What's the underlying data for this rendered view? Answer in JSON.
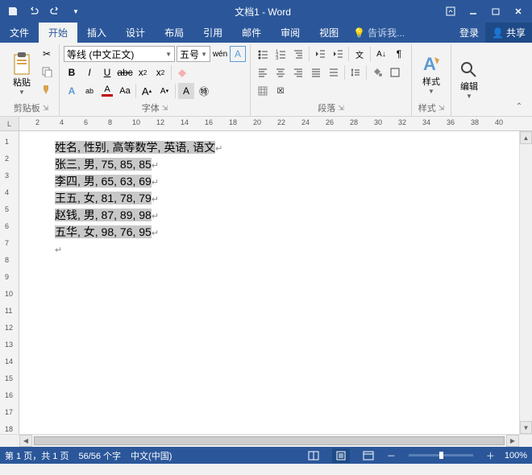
{
  "titlebar": {
    "doctitle": "文档1 - Word"
  },
  "tabs": {
    "file": "文件",
    "home": "开始",
    "insert": "插入",
    "design": "设计",
    "layout": "布局",
    "references": "引用",
    "mailings": "邮件",
    "review": "审阅",
    "view": "视图",
    "tell": "告诉我...",
    "signin": "登录",
    "share": "共享"
  },
  "ribbon": {
    "clipboard": {
      "paste": "粘贴",
      "label": "剪贴板"
    },
    "font": {
      "name": "等线 (中文正文)",
      "size": "五号",
      "bold": "B",
      "italic": "I",
      "underline": "U",
      "label": "字体"
    },
    "paragraph": {
      "label": "段落"
    },
    "styles": {
      "btn": "样式",
      "label": "样式"
    },
    "editing": {
      "btn": "编辑"
    }
  },
  "ruler": {
    "h_numbers": [
      "2",
      "4",
      "6",
      "8",
      "10",
      "12",
      "14",
      "16",
      "18",
      "20",
      "22",
      "24",
      "26",
      "28",
      "30",
      "32",
      "34",
      "36",
      "38",
      "40"
    ],
    "v_numbers": [
      "1",
      "2",
      "3",
      "4",
      "5",
      "6",
      "7",
      "8",
      "9",
      "10",
      "11",
      "12",
      "13",
      "14",
      "15",
      "16",
      "17",
      "18"
    ]
  },
  "document": {
    "lines": [
      "姓名, 性别, 高等数学, 英语, 语文",
      "张三, 男, 75, 85, 85",
      "李四, 男, 65, 63, 69",
      "王五, 女, 81, 78, 79",
      "赵钱, 男, 87, 89, 98",
      "五华, 女, 98, 76, 95"
    ]
  },
  "statusbar": {
    "page": "第 1 页，共 1 页",
    "words": "56/56 个字",
    "lang": "中文(中国)",
    "zoom_minus": "－",
    "zoom_plus": "＋",
    "zoom": "100%"
  }
}
